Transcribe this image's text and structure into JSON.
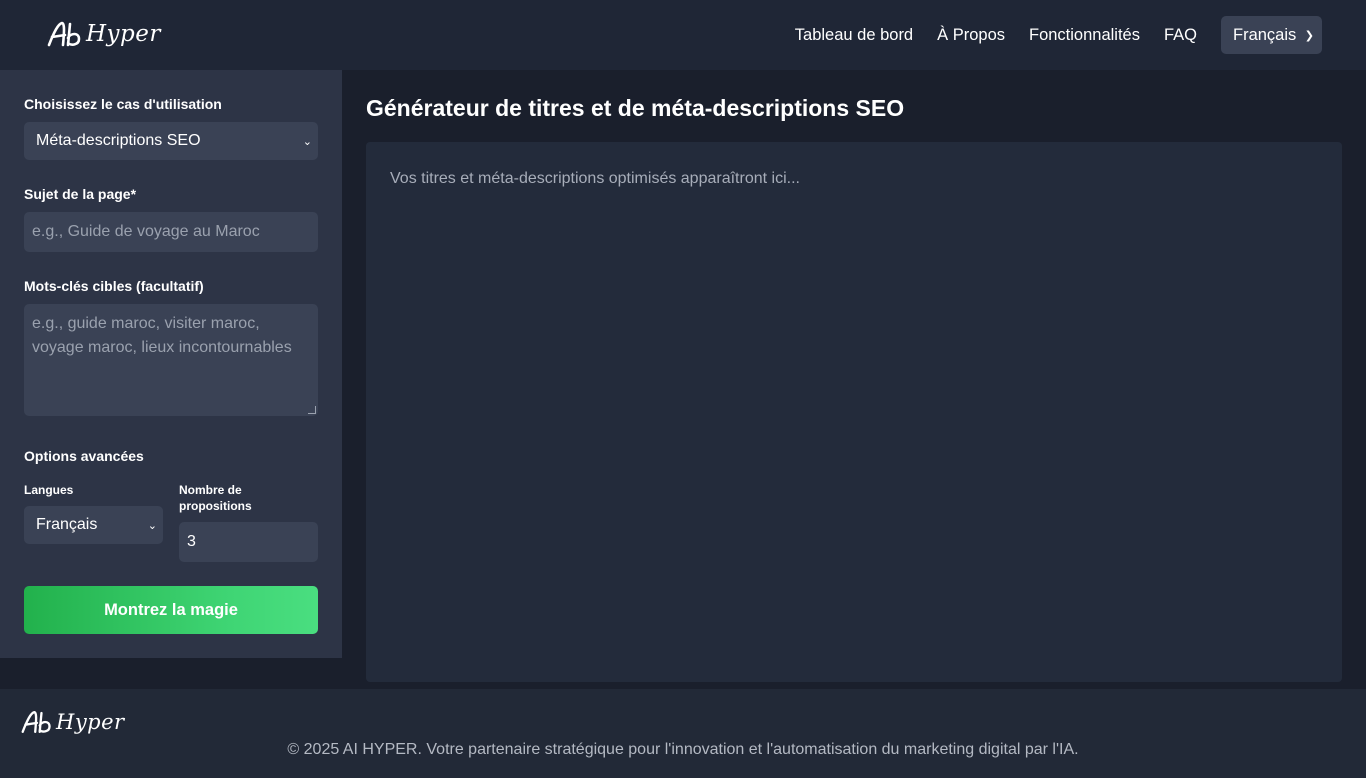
{
  "header": {
    "logo_text": "Hyper",
    "nav": [
      "Tableau de bord",
      "À Propos",
      "Fonctionnalités",
      "FAQ"
    ],
    "language": "Français"
  },
  "sidebar": {
    "use_case_label": "Choisissez le cas d'utilisation",
    "use_case_value": "Méta-descriptions SEO",
    "topic_label": "Sujet de la page*",
    "topic_placeholder": "e.g., Guide de voyage au Maroc",
    "keywords_label": "Mots-clés cibles (facultatif)",
    "keywords_placeholder": "e.g., guide maroc, visiter maroc, voyage maroc, lieux incontournables",
    "advanced_label": "Options avancées",
    "languages_label": "Langues",
    "languages_value": "Français",
    "count_label": "Nombre de propositions",
    "count_value": "3",
    "submit_label": "Montrez la magie"
  },
  "main": {
    "title": "Générateur de titres et de méta-descriptions SEO",
    "output_placeholder": "Vos titres et méta-descriptions optimisés apparaîtront ici..."
  },
  "footer": {
    "logo_text": "Hyper",
    "copyright": "© 2025 AI HYPER. Votre partenaire stratégique pour l'innovation et l'automatisation du marketing digital par l'IA."
  },
  "colors": {
    "background": "#1a1f2c",
    "header": "#1f2636",
    "sidebar": "#2d3446",
    "field": "#3a4255",
    "accent_green": "#22b14c"
  }
}
